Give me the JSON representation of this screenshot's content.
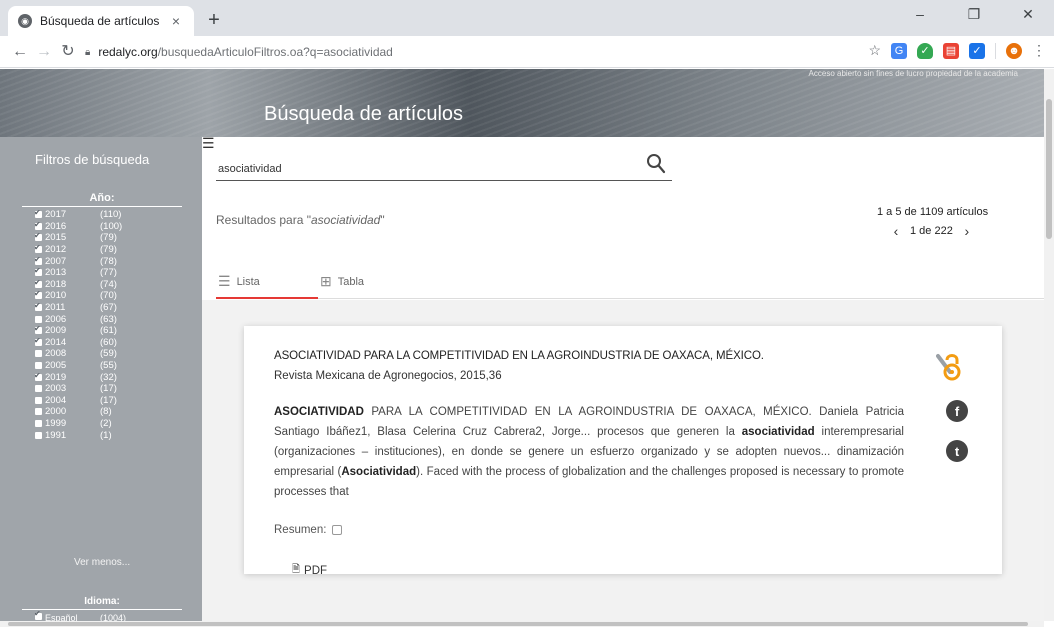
{
  "browser": {
    "tab_title": "Búsqueda de artículos",
    "tab_close": "×",
    "new_tab": "+",
    "url_host": "redalyc.org",
    "url_path": "/busquedaArticuloFiltros.oa?q=asociatividad",
    "minimize": "–",
    "restore": "❐",
    "close": "✕"
  },
  "hero": {
    "top_text": "Acceso abierto sin fines de lucro propiedad de la academia",
    "title": "Búsqueda de artículos"
  },
  "sidebar": {
    "title": "Filtros de búsqueda",
    "year_heading": "Año:",
    "years": [
      {
        "year": "2017",
        "count": "(110)",
        "checked": true
      },
      {
        "year": "2016",
        "count": "(100)",
        "checked": true
      },
      {
        "year": "2015",
        "count": "(79)",
        "checked": true
      },
      {
        "year": "2012",
        "count": "(79)",
        "checked": true
      },
      {
        "year": "2007",
        "count": "(78)",
        "checked": true
      },
      {
        "year": "2013",
        "count": "(77)",
        "checked": true
      },
      {
        "year": "2018",
        "count": "(74)",
        "checked": true
      },
      {
        "year": "2010",
        "count": "(70)",
        "checked": true
      },
      {
        "year": "2011",
        "count": "(67)",
        "checked": true
      },
      {
        "year": "2006",
        "count": "(63)",
        "checked": false
      },
      {
        "year": "2009",
        "count": "(61)",
        "checked": true
      },
      {
        "year": "2014",
        "count": "(60)",
        "checked": true
      },
      {
        "year": "2008",
        "count": "(59)",
        "checked": false
      },
      {
        "year": "2005",
        "count": "(55)",
        "checked": false
      },
      {
        "year": "2019",
        "count": "(32)",
        "checked": true
      },
      {
        "year": "2003",
        "count": "(17)",
        "checked": false
      },
      {
        "year": "2004",
        "count": "(17)",
        "checked": false
      },
      {
        "year": "2000",
        "count": "(8)",
        "checked": false
      },
      {
        "year": "1999",
        "count": "(2)",
        "checked": false
      },
      {
        "year": "1991",
        "count": "(1)",
        "checked": false
      }
    ],
    "see_less": "Ver menos...",
    "language_heading": "Idioma:",
    "language_first": {
      "label": "Español",
      "count": "(1004)"
    }
  },
  "search": {
    "value": "asociatividad",
    "results_prefix": "Resultados para \"",
    "results_term": "asociatividad",
    "results_suffix": "\""
  },
  "pager": {
    "count_text": "1 a 5 de 1109 artículos",
    "prev": "‹",
    "page_text": "1 de 222",
    "next": "›"
  },
  "view_tabs": {
    "list_label": "Lista",
    "table_label": "Tabla"
  },
  "result": {
    "title": "ASOCIATIVIDAD PARA LA COMPETITIVIDAD EN LA AGROINDUSTRIA DE OAXACA, MÉXICO.",
    "journal": "Revista Mexicana de Agronegocios, 2015,36",
    "body_1": "ASOCIATIVIDAD",
    "body_2": " PARA LA COMPETITIVIDAD EN LA AGROINDUSTRIA DE OAXACA, MÉXICO. Daniela Patricia Santiago Ibáñez1, Blasa Celerina Cruz Cabrera2, Jorge... procesos que generen la ",
    "body_3": "asociatividad",
    "body_4": " interempresarial (organizaciones – instituciones), en donde se genere un esfuerzo organizado y se adopten nuevos... dinamización empresarial (",
    "body_5": "Asociatividad",
    "body_6": "). Faced with the process of globalization and the challenges proposed is necessary to promote processes that",
    "resumen_label": "Resumen:",
    "pdf_label": "PDF",
    "facebook_glyph": "f",
    "twitter_glyph": "t"
  },
  "colors": {
    "accent_red": "#e53935",
    "sidebar_bg": "#a0a5aa",
    "oa_orange": "#f39c12"
  }
}
